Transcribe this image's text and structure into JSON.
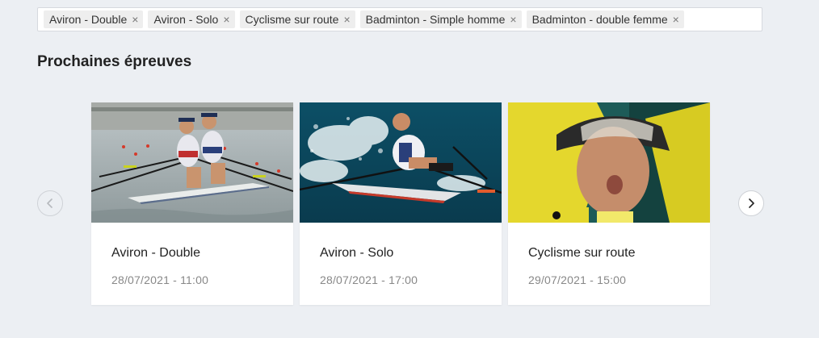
{
  "filters": {
    "tags": [
      {
        "label": "Aviron - Double"
      },
      {
        "label": "Aviron - Solo"
      },
      {
        "label": "Cyclisme sur route"
      },
      {
        "label": "Badminton - Simple homme"
      },
      {
        "label": "Badminton - double femme"
      }
    ],
    "remove_glyph": "×"
  },
  "section": {
    "title": "Prochaines épreuves"
  },
  "carousel": {
    "prev_icon": "chevron-left-icon",
    "next_icon": "chevron-right-icon",
    "cards": [
      {
        "title": "Aviron - Double",
        "date": "28/07/2021 - 11:00",
        "image": "rowing-double-photo"
      },
      {
        "title": "Aviron - Solo",
        "date": "28/07/2021 - 17:00",
        "image": "rowing-single-photo"
      },
      {
        "title": "Cyclisme sur route",
        "date": "29/07/2021 - 15:00",
        "image": "road-cycling-photo"
      }
    ]
  },
  "colors": {
    "background": "#eceff3",
    "card": "#ffffff",
    "tag": "#eeeeee",
    "date_text": "#888888"
  }
}
